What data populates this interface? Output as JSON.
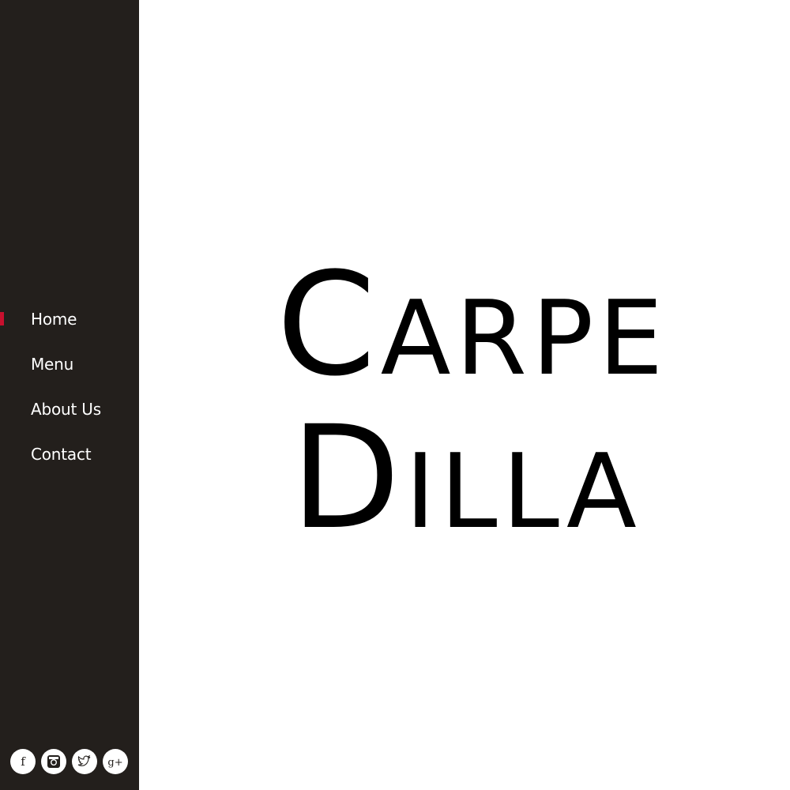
{
  "nav": {
    "items": [
      {
        "label": "Home",
        "active": true
      },
      {
        "label": "Menu",
        "active": false
      },
      {
        "label": "About Us",
        "active": false
      },
      {
        "label": "Contact",
        "active": false
      }
    ]
  },
  "social": [
    {
      "icon": "facebook-icon",
      "glyph": "f"
    },
    {
      "icon": "instagram-icon"
    },
    {
      "icon": "twitter-icon"
    },
    {
      "icon": "google-plus-icon",
      "glyph": "g+"
    }
  ],
  "logo": {
    "line1_initial": "C",
    "line1_rest": "ARPE",
    "line2_initial": "D",
    "line2_rest": "ILLA"
  },
  "colors": {
    "sidebar": "#231f1c",
    "accent": "#c8102e",
    "nav_text": "#ffffff",
    "logo_text": "#000000"
  }
}
